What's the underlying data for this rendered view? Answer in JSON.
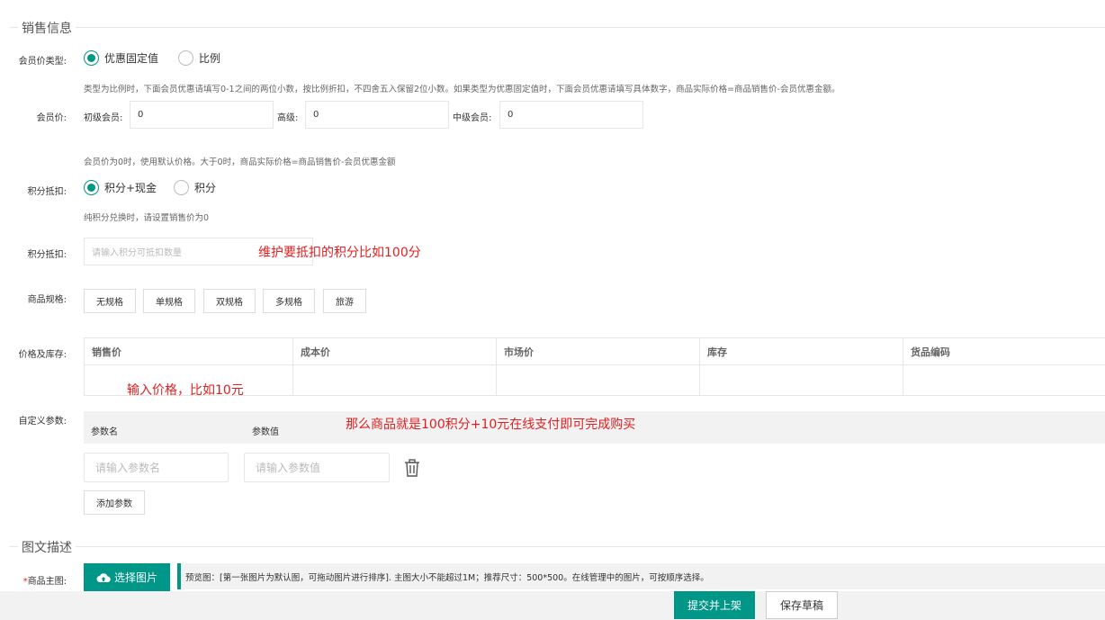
{
  "sales_section": {
    "title": "销售信息"
  },
  "member_price_type": {
    "label": "会员价类型:",
    "options": [
      "优惠固定值",
      "比例"
    ],
    "selected": 0,
    "hint": "类型为比例时，下面会员优惠请填写0-1之间的两位小数，按比例折扣，不四舍五入保留2位小数。如果类型为优惠固定值时，下面会员优惠请填写具体数字，商品实际价格=商品销售价-会员优惠金额。"
  },
  "member_price": {
    "label": "会员价:",
    "fields": [
      {
        "label": "初级会员:",
        "value": "0"
      },
      {
        "label": "高级:",
        "value": "0"
      },
      {
        "label": "中级会员:",
        "value": "0"
      }
    ],
    "hint": "会员价为0时，使用默认价格。大于0时，商品实际价格=商品销售价-会员优惠金额"
  },
  "points_mode": {
    "label": "积分抵扣:",
    "options": [
      "积分+现金",
      "积分"
    ],
    "selected": 0,
    "hint": "纯积分兑换时，请设置销售价为0"
  },
  "points_deduct": {
    "label": "积分抵扣:",
    "placeholder": "请输入积分可抵扣数量",
    "annotation": "维护要抵扣的积分比如100分"
  },
  "spec": {
    "label": "商品规格:",
    "buttons": [
      "无规格",
      "单规格",
      "双规格",
      "多规格",
      "旅游"
    ]
  },
  "price_stock": {
    "label": "价格及库存:",
    "columns": [
      "销售价",
      "成本价",
      "市场价",
      "库存",
      "货品编码"
    ],
    "annotation": "输入价格，比如10元"
  },
  "custom_params": {
    "label": "自定义参数:",
    "header_name": "参数名",
    "header_value": "参数值",
    "annotation": "那么商品就是100积分+10元在线支付即可完成购买",
    "name_placeholder": "请输入参数名",
    "value_placeholder": "请输入参数值",
    "add_label": "添加参数"
  },
  "desc_section": {
    "title": "图文描述"
  },
  "main_image": {
    "label": "*商品主图:",
    "button": "选择图片",
    "hint": "预览图：[第一张图片为默认图，可拖动图片进行排序]. 主图大小不能超过1M；推荐尺寸：500*500。在线管理中的图片，可按顺序选择。"
  },
  "footer": {
    "submit": "提交并上架",
    "draft": "保存草稿"
  },
  "colors": {
    "accent": "#009688",
    "annotation": "#e02020"
  }
}
